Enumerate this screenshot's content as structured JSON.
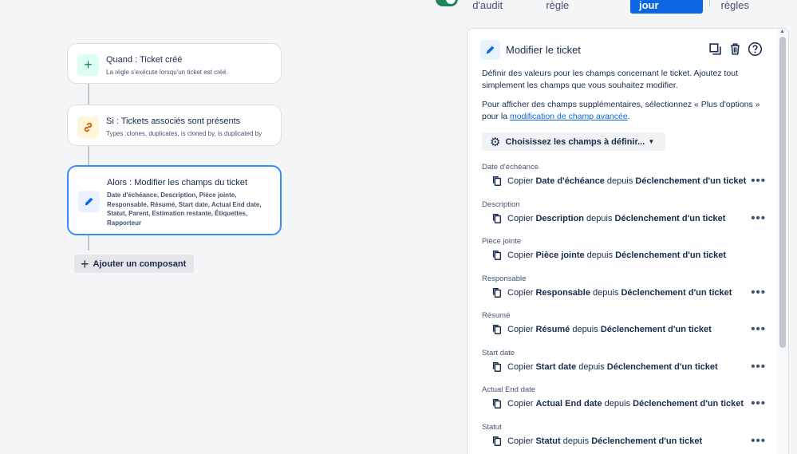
{
  "topbar": {
    "journal": "Journal d'audit",
    "details": "Détails de la règle",
    "update": "Mettre à jour",
    "back": "Revenir aux règles"
  },
  "flow": {
    "trigger": {
      "title": "Quand : Ticket créé",
      "subtitle": "La règle s'exécute lorsqu'un ticket est créé."
    },
    "condition": {
      "title": "Si : Tickets associés sont présents",
      "subtitle": "Types :clones, duplicates, is cloned by, is duplicated by"
    },
    "action": {
      "title": "Alors : Modifier les champs du ticket",
      "subtitle": "Date d'échéance, Description, Pièce jointe, Responsable, Résumé, Start date, Actual End date, Statut, Parent, Estimation restante, Étiquettes, Rapporteur"
    },
    "add_component": "Ajouter un composant"
  },
  "panel": {
    "title": "Modifier le ticket",
    "desc1": "Définir des valeurs pour les champs concernant le ticket. Ajoutez tout simplement les champs que vous souhaitez modifier.",
    "desc2_before": "Pour afficher des champs supplémentaires, sélectionnez « Plus d'options » pour la ",
    "desc2_link": "modification de champ avancée",
    "desc2_after": ".",
    "choose_fields": "Choisissez les champs à définir...",
    "copy_word": "Copier",
    "from_word": "depuis",
    "source": "Déclenchement d'un ticket",
    "fields": [
      {
        "label": "Date d'échéance",
        "name": "Date d'échéance"
      },
      {
        "label": "Description",
        "name": "Description"
      },
      {
        "label": "Pièce jointe",
        "name": "Pièce jointe"
      },
      {
        "label": "Responsable",
        "name": "Responsable"
      },
      {
        "label": "Résumé",
        "name": "Résumé"
      },
      {
        "label": "Start date",
        "name": "Start date"
      },
      {
        "label": "Actual End date",
        "name": "Actual End date"
      },
      {
        "label": "Statut",
        "name": "Statut"
      }
    ],
    "more_flags": [
      true,
      true,
      false,
      true,
      true,
      true,
      true,
      true
    ]
  },
  "colors": {
    "accent": "#0c66e4",
    "selected_border": "#388bff",
    "toggle": "#1f845a"
  }
}
